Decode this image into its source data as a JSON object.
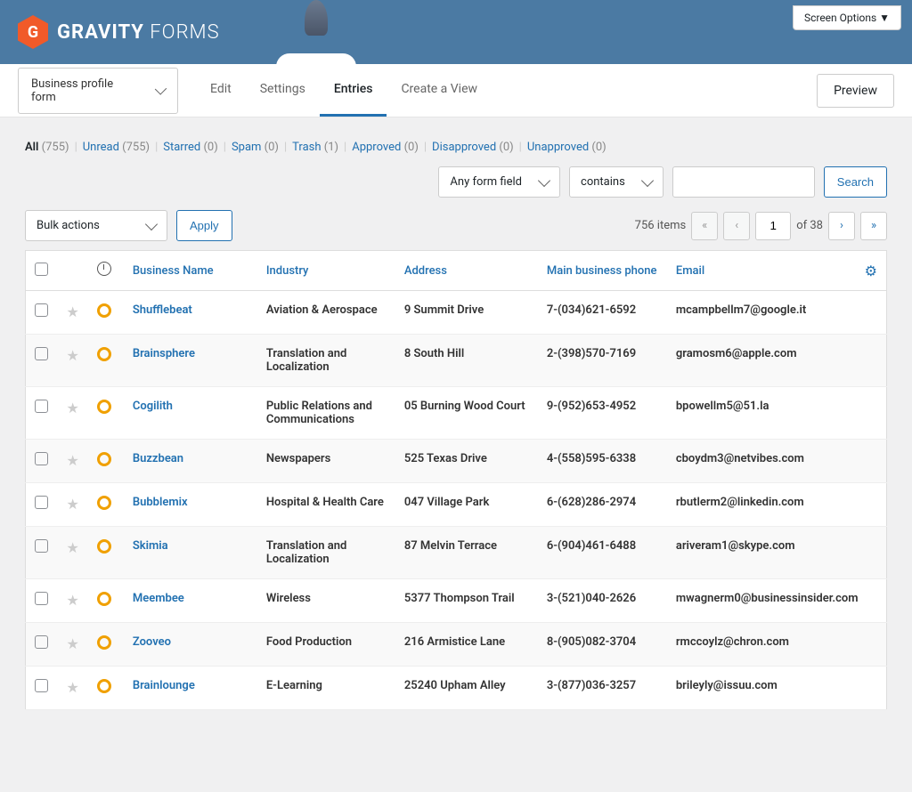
{
  "header": {
    "screen_options": "Screen Options ▼",
    "logo_bold": "GRAVITY",
    "logo_light": " FORMS",
    "logo_badge": "G"
  },
  "form_selector": "Business profile form",
  "tabs": {
    "edit": "Edit",
    "settings": "Settings",
    "entries": "Entries",
    "create_view": "Create a View"
  },
  "preview_btn": "Preview",
  "filters": [
    {
      "label": "All",
      "count": "(755)",
      "current": true
    },
    {
      "label": "Unread",
      "count": "(755)"
    },
    {
      "label": "Starred",
      "count": "(0)"
    },
    {
      "label": "Spam",
      "count": "(0)"
    },
    {
      "label": "Trash",
      "count": "(1)"
    },
    {
      "label": "Approved",
      "count": "(0)"
    },
    {
      "label": "Disapproved",
      "count": "(0)"
    },
    {
      "label": "Unapproved",
      "count": "(0)"
    }
  ],
  "search": {
    "field_select": "Any form field",
    "operator": "contains",
    "button": "Search"
  },
  "bulk": {
    "select": "Bulk actions",
    "apply": "Apply"
  },
  "pagination": {
    "items_text": "756 items",
    "current": "1",
    "of_text": "of 38"
  },
  "columns": {
    "name": "Business Name",
    "industry": "Industry",
    "address": "Address",
    "phone": "Main business phone",
    "email": "Email"
  },
  "rows": [
    {
      "name": "Shufflebeat",
      "industry": "Aviation & Aerospace",
      "address": "9 Summit Drive",
      "phone": "7-(034)621-6592",
      "email": "mcampbellm7@google.it"
    },
    {
      "name": "Brainsphere",
      "industry": "Translation and Localization",
      "address": "8 South Hill",
      "phone": "2-(398)570-7169",
      "email": "gramosm6@apple.com"
    },
    {
      "name": "Cogilith",
      "industry": "Public Relations and Communications",
      "address": "05 Burning Wood Court",
      "phone": "9-(952)653-4952",
      "email": "bpowellm5@51.la"
    },
    {
      "name": "Buzzbean",
      "industry": "Newspapers",
      "address": "525 Texas Drive",
      "phone": "4-(558)595-6338",
      "email": "cboydm3@netvibes.com"
    },
    {
      "name": "Bubblemix",
      "industry": "Hospital & Health Care",
      "address": "047 Village Park",
      "phone": "6-(628)286-2974",
      "email": "rbutlerm2@linkedin.com"
    },
    {
      "name": "Skimia",
      "industry": "Translation and Localization",
      "address": "87 Melvin Terrace",
      "phone": "6-(904)461-6488",
      "email": "ariveram1@skype.com"
    },
    {
      "name": "Meembee",
      "industry": "Wireless",
      "address": "5377 Thompson Trail",
      "phone": "3-(521)040-2626",
      "email": "mwagnerm0@businessinsider.com"
    },
    {
      "name": "Zooveo",
      "industry": "Food Production",
      "address": "216 Armistice Lane",
      "phone": "8-(905)082-3704",
      "email": "rmccoylz@chron.com"
    },
    {
      "name": "Brainlounge",
      "industry": "E-Learning",
      "address": "25240 Upham Alley",
      "phone": "3-(877)036-3257",
      "email": "brileyly@issuu.com"
    }
  ]
}
